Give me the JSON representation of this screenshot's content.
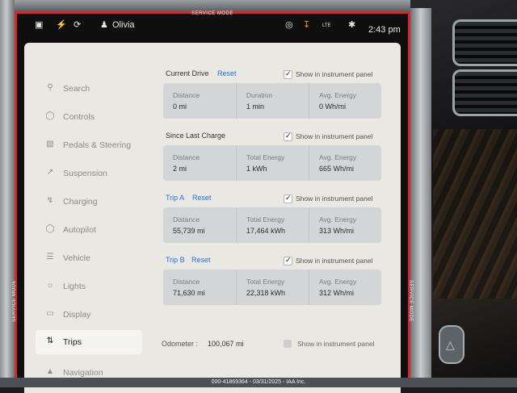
{
  "service_mode": "SERVICE MODE",
  "status_bar": {
    "user": "Olivia",
    "network": "LTE",
    "time": "2:43 pm"
  },
  "nav": [
    {
      "label": "Search",
      "icon": "search-icon"
    },
    {
      "label": "Controls",
      "icon": "toggle-icon"
    },
    {
      "label": "Pedals & Steering",
      "icon": "car-icon"
    },
    {
      "label": "Suspension",
      "icon": "suspension-icon"
    },
    {
      "label": "Charging",
      "icon": "bolt-icon"
    },
    {
      "label": "Autopilot",
      "icon": "steering-wheel-icon"
    },
    {
      "label": "Vehicle",
      "icon": "sliders-icon"
    },
    {
      "label": "Lights",
      "icon": "sun-icon"
    },
    {
      "label": "Display",
      "icon": "display-icon"
    },
    {
      "label": "Trips",
      "icon": "trips-icon",
      "active": true
    },
    {
      "label": "Navigation",
      "icon": "navigation-icon"
    }
  ],
  "sections": [
    {
      "title": "Current Drive",
      "reset": "Reset",
      "show_in_panel": true,
      "show_label": "Show in instrument panel",
      "stats": [
        {
          "key": "Distance",
          "value": "0 mi"
        },
        {
          "key": "Duration",
          "value": "1 min"
        },
        {
          "key": "Avg. Energy",
          "value": "0 Wh/mi"
        }
      ]
    },
    {
      "title": "Since Last Charge",
      "reset": "",
      "show_in_panel": true,
      "show_label": "Show in instrument panel",
      "stats": [
        {
          "key": "Distance",
          "value": "2 mi"
        },
        {
          "key": "Total Energy",
          "value": "1 kWh"
        },
        {
          "key": "Avg. Energy",
          "value": "665 Wh/mi"
        }
      ]
    },
    {
      "title": "Trip A",
      "reset": "Reset",
      "show_in_panel": true,
      "show_label": "Show in instrument panel",
      "stats": [
        {
          "key": "Distance",
          "value": "55,739 mi"
        },
        {
          "key": "Total Energy",
          "value": "17,464 kWh"
        },
        {
          "key": "Avg. Energy",
          "value": "313 Wh/mi"
        }
      ]
    },
    {
      "title": "Trip B",
      "reset": "Reset",
      "show_in_panel": true,
      "show_label": "Show in instrument panel",
      "stats": [
        {
          "key": "Distance",
          "value": "71,630 mi"
        },
        {
          "key": "Total Energy",
          "value": "22,318 kWh"
        },
        {
          "key": "Avg. Energy",
          "value": "312 Wh/mi"
        }
      ]
    }
  ],
  "odometer": {
    "label": "Odometer :",
    "value": "100,067 mi",
    "show_in_panel": false,
    "show_label": "Show in instrument panel"
  },
  "footer": "000-41869364 - 03/31/2025 - IAA Inc."
}
